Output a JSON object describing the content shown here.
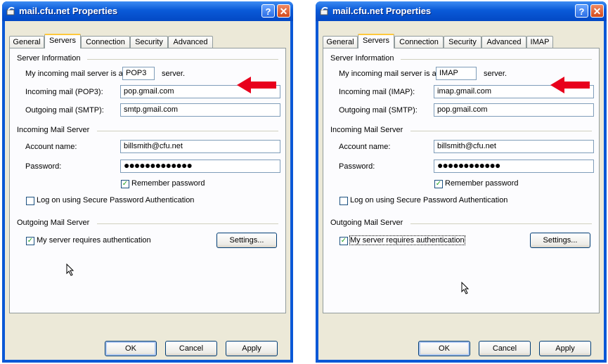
{
  "dialogs": [
    {
      "title": "mail.cfu.net Properties",
      "tabs": [
        "General",
        "Servers",
        "Connection",
        "Security",
        "Advanced"
      ],
      "active_tab": "Servers",
      "server_info": {
        "heading": "Server Information",
        "incoming_type_prefix": "My incoming mail server is a",
        "incoming_type_value": "POP3",
        "incoming_type_suffix": "server.",
        "incoming_label": "Incoming mail (POP3):",
        "incoming_value": "pop.gmail.com",
        "outgoing_label": "Outgoing mail (SMTP):",
        "outgoing_value": "smtp.gmail.com"
      },
      "incoming_server": {
        "heading": "Incoming Mail Server",
        "account_label": "Account name:",
        "account_value": "billsmith@cfu.net",
        "password_label": "Password:",
        "password_value": "●●●●●●●●●●●●●",
        "remember_label": "Remember password",
        "remember_checked": true,
        "spa_label": "Log on using Secure Password Authentication",
        "spa_checked": false
      },
      "outgoing_server": {
        "heading": "Outgoing Mail Server",
        "auth_label": "My server requires authentication",
        "auth_checked": true,
        "settings_label": "Settings..."
      },
      "buttons": {
        "ok": "OK",
        "cancel": "Cancel",
        "apply": "Apply"
      }
    },
    {
      "title": "mail.cfu.net Properties",
      "tabs": [
        "General",
        "Servers",
        "Connection",
        "Security",
        "Advanced",
        "IMAP"
      ],
      "active_tab": "Servers",
      "server_info": {
        "heading": "Server Information",
        "incoming_type_prefix": "My incoming mail server is a",
        "incoming_type_value": "IMAP",
        "incoming_type_suffix": "server.",
        "incoming_label": "Incoming mail (IMAP):",
        "incoming_value": "imap.gmail.com",
        "outgoing_label": "Outgoing mail (SMTP):",
        "outgoing_value": "pop.gmail.com"
      },
      "incoming_server": {
        "heading": "Incoming Mail Server",
        "account_label": "Account name:",
        "account_value": "billsmith@cfu.net",
        "password_label": "Password:",
        "password_value": "●●●●●●●●●●●●",
        "remember_label": "Remember password",
        "remember_checked": true,
        "spa_label": "Log on using Secure Password Authentication",
        "spa_checked": false
      },
      "outgoing_server": {
        "heading": "Outgoing Mail Server",
        "auth_label": "My server requires authentication",
        "auth_checked": true,
        "settings_label": "Settings..."
      },
      "buttons": {
        "ok": "OK",
        "cancel": "Cancel",
        "apply": "Apply"
      }
    }
  ],
  "icons": {
    "title_icon": "mail-account-icon",
    "help": "?",
    "close": "✕",
    "check": "✓",
    "annotation": "red-arrow-icon",
    "pointer": "mouse-pointer-icon"
  },
  "colors": {
    "titlebar": "#0a58d6",
    "dialog_bg": "#ece9d8",
    "annotation_arrow": "#e8001c",
    "check": "#21a121"
  }
}
